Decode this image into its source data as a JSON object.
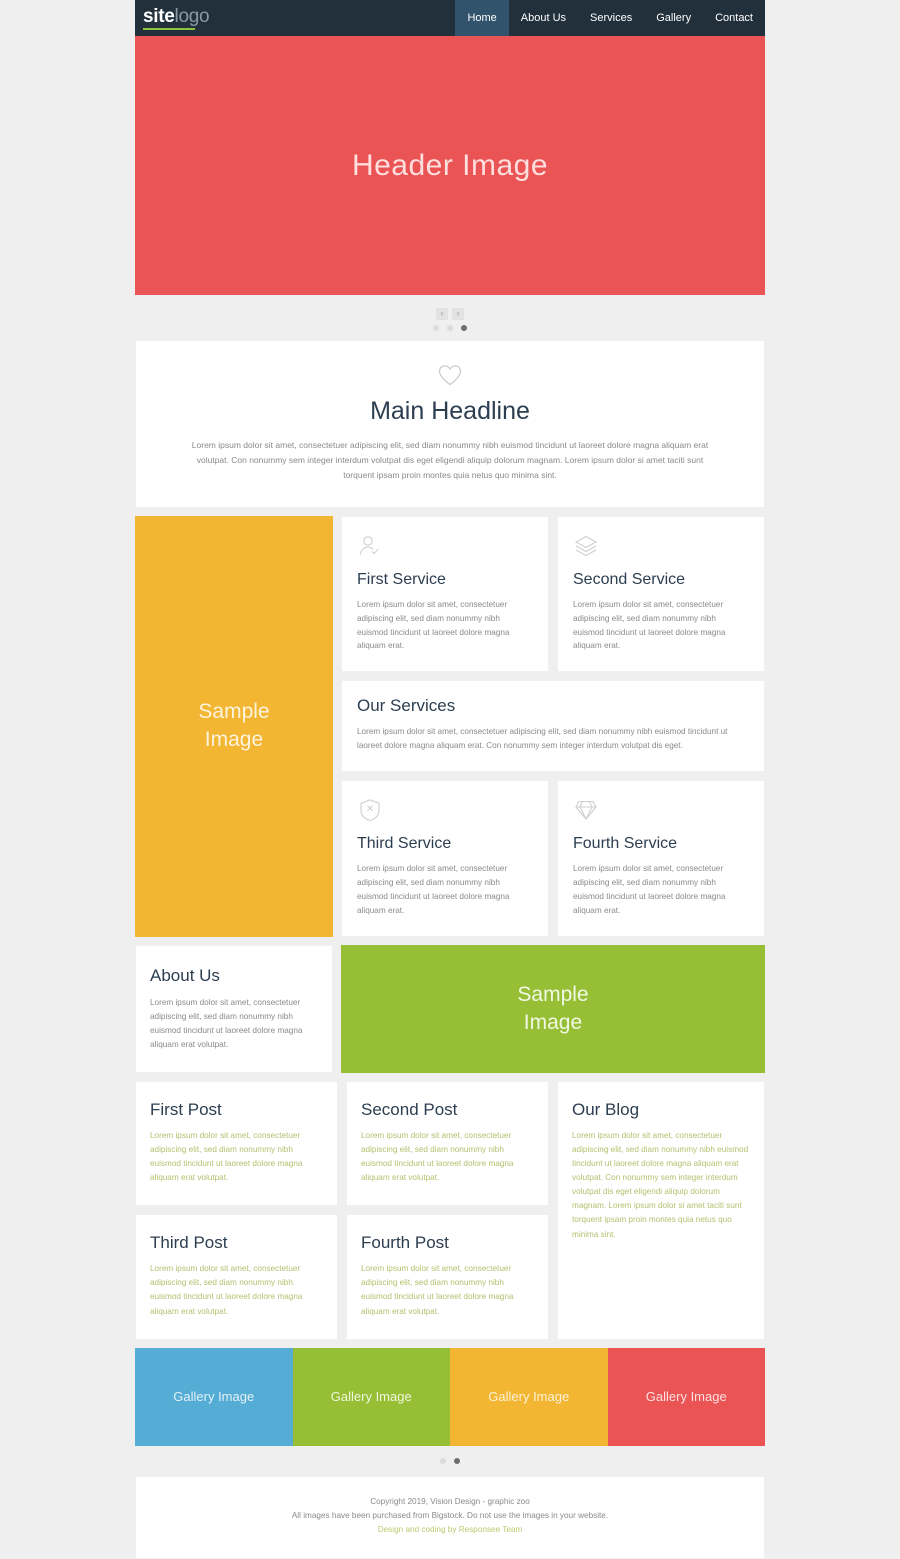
{
  "nav": {
    "logo_primary": "site",
    "logo_secondary": "logo",
    "items": [
      {
        "label": "Home",
        "active": true
      },
      {
        "label": "About Us",
        "active": false
      },
      {
        "label": "Services",
        "active": false
      },
      {
        "label": "Gallery",
        "active": false
      },
      {
        "label": "Contact",
        "active": false
      }
    ]
  },
  "hero": {
    "caption": "Header Image",
    "bg_color": "#ea5455",
    "prev_label": "‹",
    "next_label": "›",
    "dots": [
      {
        "active": false
      },
      {
        "active": false
      },
      {
        "active": true
      }
    ]
  },
  "headline": {
    "icon": "heart-icon",
    "title": "Main Headline",
    "body": "Lorem ipsum dolor sit amet, consectetuer adipiscing elit, sed diam nonummy nibh euismod tincidunt ut laoreet dolore magna aliquam erat volutpat. Con nonummy sem integer interdum volutpat dis eget eligendi aliquip dolorum magnam. Lorem ipsum dolor si amet taciti sunt torquent ipsam proin montes quia netus quo minima sint."
  },
  "services": {
    "sample_image_label": "Sample\nImage",
    "sample_image_color": "#f2b632",
    "cards": [
      {
        "icon": "user-check-icon",
        "title": "First Service",
        "body": "Lorem ipsum dolor sit amet, consectetuer adipiscing elit, sed diam nonummy nibh euismod tincidunt ut laoreet dolore magna aliquam erat."
      },
      {
        "icon": "layers-icon",
        "title": "Second Service",
        "body": "Lorem ipsum dolor sit amet, consectetuer adipiscing elit, sed diam nonummy nibh euismod tincidunt ut laoreet dolore magna aliquam erat."
      },
      {
        "icon": "shield-x-icon",
        "title": "Third Service",
        "body": "Lorem ipsum dolor sit amet, consectetuer adipiscing elit, sed diam nonummy nibh euismod tincidunt ut laoreet dolore magna aliquam erat."
      },
      {
        "icon": "diamond-icon",
        "title": "Fourth Service",
        "body": "Lorem ipsum dolor sit amet, consectetuer adipiscing elit, sed diam nonummy nibh euismod tincidunt ut laoreet dolore magna aliquam erat."
      }
    ],
    "overview": {
      "title": "Our Services",
      "body": "Lorem ipsum dolor sit amet, consectetuer adipiscing elit, sed diam nonummy nibh euismod tincidunt ut laoreet dolore magna aliquam erat. Con nonummy sem integer interdum volutpat dis eget."
    }
  },
  "about": {
    "title": "About Us",
    "body": "Lorem ipsum dolor sit amet, consectetuer adipiscing elit, sed diam nonummy nibh euismod tincidunt ut laoreet dolore magna aliquam erat volutpat.",
    "sample_image_label": "Sample\nImage",
    "sample_image_color": "#96bf35"
  },
  "blog": {
    "posts": [
      {
        "title": "First Post",
        "body": "Lorem ipsum dolor sit amet, consectetuer adipiscing elit, sed diam nonummy nibh euismod tincidunt ut laoreet dolore magna aliquam erat volutpat."
      },
      {
        "title": "Second Post",
        "body": "Lorem ipsum dolor sit amet, consectetuer adipiscing elit, sed diam nonummy nibh euismod tincidunt ut laoreet dolore magna aliquam erat volutpat."
      },
      {
        "title": "Third Post",
        "body": "Lorem ipsum dolor sit amet, consectetuer adipiscing elit, sed diam nonummy nibh euismod tincidunt ut laoreet dolore magna aliquam erat volutpat."
      },
      {
        "title": "Fourth Post",
        "body": "Lorem ipsum dolor sit amet, consectetuer adipiscing elit, sed diam nonummy nibh euismod tincidunt ut laoreet dolore magna aliquam erat volutpat."
      }
    ],
    "sidebar": {
      "title": "Our Blog",
      "body": "Lorem ipsum dolor sit amet, consectetuer adipiscing elit, sed diam nonummy nibh euismod tincidunt ut laoreet dolore magna aliquam erat volutpat. Con nonummy sem integer interdum volutpat dis eget eligendi aliquip dolorum magnam. Lorem ipsum dolor si amet taciti sunt torquent ipsam proin montes quia netus quo minima sint."
    },
    "body_color": "#b5bf6e"
  },
  "gallery": {
    "tiles": [
      {
        "label": "Gallery Image",
        "color": "#55acd4"
      },
      {
        "label": "Gallery Image",
        "color": "#96bf35"
      },
      {
        "label": "Gallery Image",
        "color": "#f2b632"
      },
      {
        "label": "Gallery Image",
        "color": "#ea5455"
      }
    ],
    "dots": [
      {
        "active": false
      },
      {
        "active": true
      }
    ]
  },
  "footer": {
    "copyright": "Copyright 2019, Vision Design - graphic zoo",
    "notice": "All images have been purchased from Bigstock. Do not use the images in your website.",
    "credit": "Design and coding by Responsee Team",
    "credit_color": "#bcc96f"
  }
}
